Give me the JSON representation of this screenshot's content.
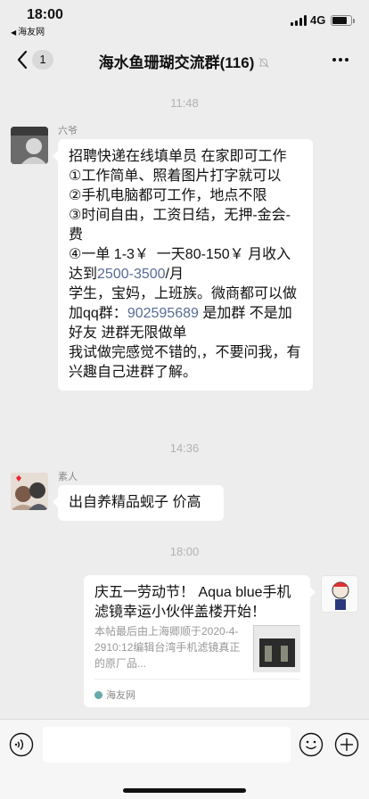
{
  "status_bar": {
    "time": "18:00",
    "back_app": "海友网",
    "network": "4G"
  },
  "nav": {
    "back_badge": "1",
    "title": "海水鱼珊瑚交流群(116)"
  },
  "timestamps": [
    "11:48",
    "14:36",
    "18:00"
  ],
  "messages": [
    {
      "sender": "六爷",
      "lines": [
        [
          {
            "t": "招聘快递在线填单员 在家即可工作"
          }
        ],
        [
          {
            "t": "①工作简单、照着图片打字就可以"
          }
        ],
        [
          {
            "t": "②手机电脑都可工作，地点不限"
          }
        ],
        [
          {
            "t": "③时间自由，工资日结，无押-金会-费"
          }
        ],
        [
          {
            "t": "④一单 1-3￥  一天80-150￥ 月收入达到"
          },
          {
            "t": "2500-3500",
            "link": true
          },
          {
            "t": "/月"
          }
        ],
        [
          {
            "t": "学生，宝妈，上班族。微商都可以做"
          }
        ],
        [
          {
            "t": "加qq群："
          },
          {
            "t": "902595689",
            "link": true
          },
          {
            "t": " 是加群 不是加好友 进群无限做单"
          }
        ],
        [
          {
            "t": "我试做完感觉不错的,，不要问我，有兴趣自己进群了解。"
          }
        ]
      ]
    },
    {
      "sender": "素人",
      "lines": [
        [
          {
            "t": "出自养精品蚬子 价高"
          }
        ]
      ]
    }
  ],
  "link_card": {
    "title": "庆五一劳动节！ Aqua blue手机滤镜幸运小伙伴盖楼开始！",
    "desc": "本帖最后由上海卿顺于2020-4-2910:12编辑台湾手机滤镜真正的原厂品...",
    "source": "海友网"
  },
  "colors": {
    "background": "#ededed",
    "bubble": "#ffffff",
    "link": "#576b95",
    "timestamp": "#b2b2b2"
  }
}
